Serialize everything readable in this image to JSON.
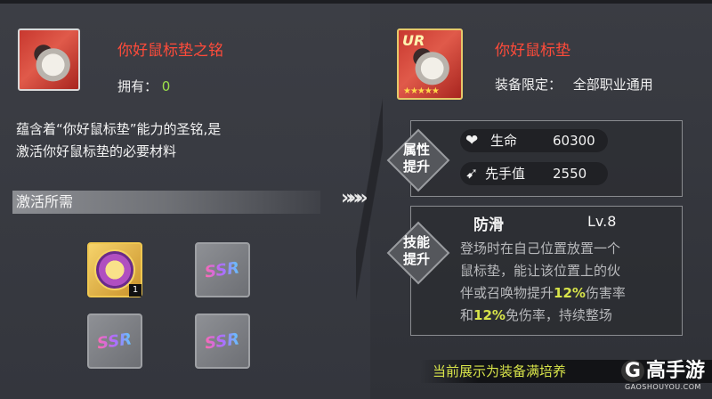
{
  "left": {
    "item_name": "你好鼠标垫之铭",
    "own_label": "拥有：",
    "own_count": "0",
    "description_line1": "蕴含着“你好鼠标垫”能力的圣铭,是",
    "description_line2": "激活你好鼠标垫的必要材料",
    "requirements_title": "激活所需",
    "materials": [
      {
        "type": "medal",
        "count": "1"
      },
      {
        "type": "ssr",
        "label": "SSR"
      },
      {
        "type": "ssr",
        "label": "SSR"
      },
      {
        "type": "ssr",
        "label": "SSR"
      }
    ]
  },
  "arrows": "»»»",
  "right": {
    "rarity": "UR",
    "item_name": "你好鼠标垫",
    "equip_limit_label": "装备限定：",
    "equip_limit_value": "全部职业通用",
    "attr_title_line1": "属性",
    "attr_title_line2": "提升",
    "stats": [
      {
        "icon": "heart-icon",
        "glyph": "❤",
        "name": "生命",
        "value": "60300"
      },
      {
        "icon": "speed-icon",
        "glyph": "➹",
        "name": "先手值",
        "value": "2550"
      }
    ],
    "skill_title_line1": "技能",
    "skill_title_line2": "提升",
    "skill_name": "防滑",
    "skill_level": "Lv.8",
    "skill_line1": "登场时在自己位置放置一个",
    "skill_line2": "鼠标垫，能让该位置上的伙",
    "skill_line3_a": "伴或召唤物提升",
    "skill_line3_pct": "12%",
    "skill_line3_b": "伤害率",
    "skill_line4_a": "和",
    "skill_line4_pct": "12%",
    "skill_line4_b": "免伤率，持续整场",
    "bottom_note": "当前展示为装备满培养"
  },
  "watermark": {
    "brand": "高手游",
    "g": "G",
    "url": "GAOSHOUYOU.COM"
  },
  "colors": {
    "title_red": "#ff4b3a",
    "accent_green": "#9be04a",
    "highlight_yellow": "#d8e44a"
  }
}
